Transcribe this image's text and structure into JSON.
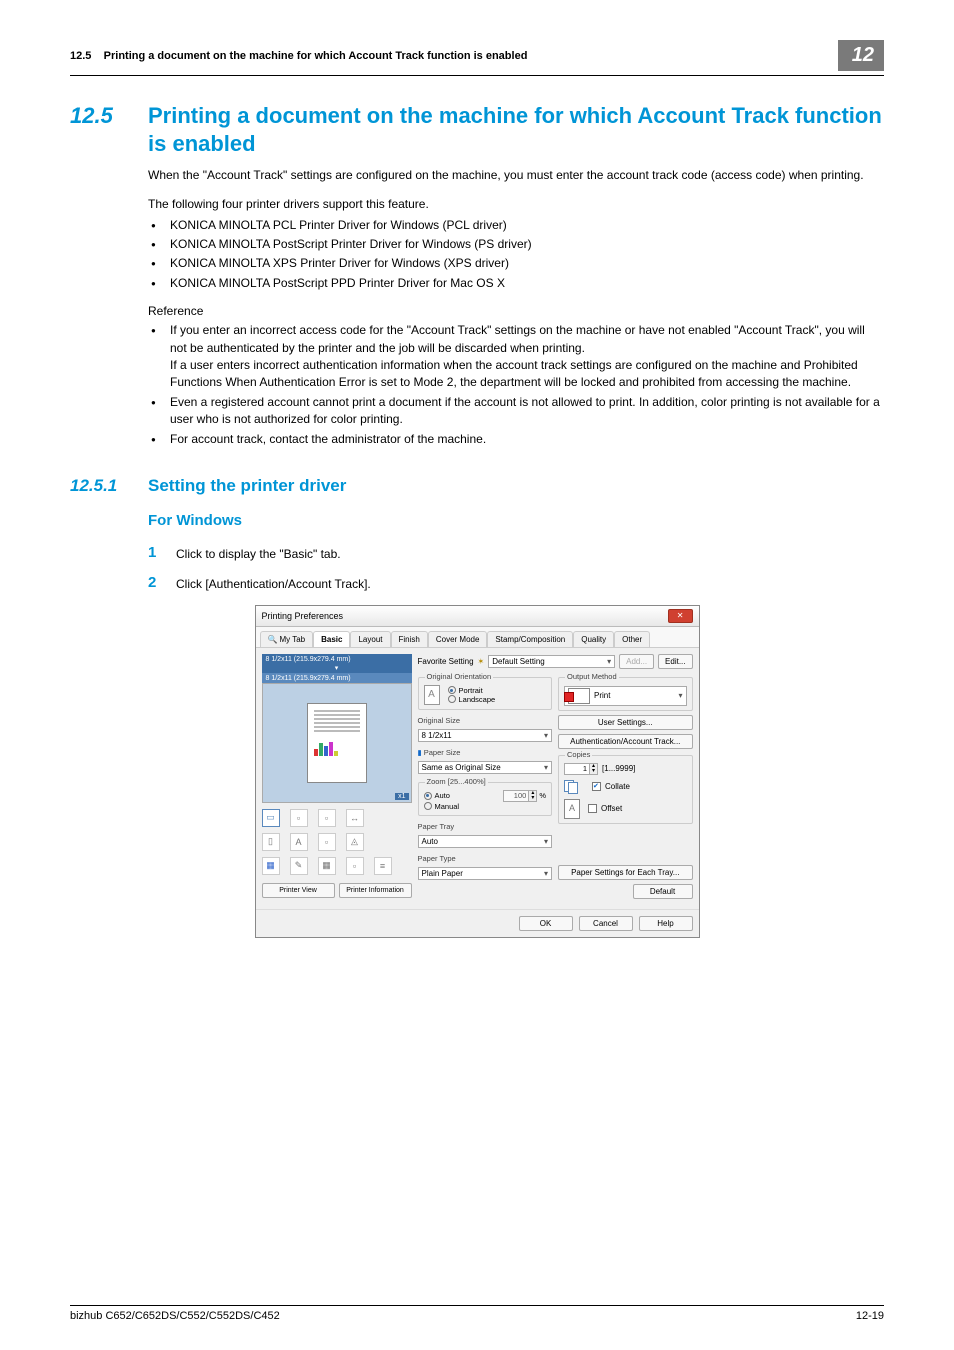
{
  "header": {
    "section_ref": "12.5",
    "running_title": "Printing a document on the machine for which Account Track function is enabled",
    "chapter_box": "12"
  },
  "section": {
    "number": "12.5",
    "title": "Printing a document on the machine for which Account Track function is enabled"
  },
  "intro1": "When the \"Account Track\" settings are configured on the machine, you must enter the account track code (access code) when printing.",
  "intro2": "The following four printer drivers support this feature.",
  "drivers": [
    "KONICA MINOLTA PCL Printer Driver for Windows (PCL driver)",
    "KONICA MINOLTA PostScript Printer Driver for Windows (PS driver)",
    "KONICA MINOLTA XPS Printer Driver for Windows (XPS driver)",
    "KONICA MINOLTA PostScript PPD Printer Driver for Mac OS X"
  ],
  "reference_label": "Reference",
  "refs": [
    "If you enter an incorrect access code for the \"Account Track\" settings on the machine or have not enabled \"Account Track\", you will not be authenticated by the printer and the job will be discarded when printing.\nIf a user enters incorrect authentication information when the account track settings are configured on the machine and Prohibited Functions When Authentication Error is set to Mode 2, the department will be locked and prohibited from accessing the machine.",
    "Even a registered account cannot print a document if the account is not allowed to print. In addition, color printing is not available for a user who is not authorized for color printing.",
    "For account track, contact the administrator of the machine."
  ],
  "subsection": {
    "number": "12.5.1",
    "title": "Setting the printer driver"
  },
  "for_windows": "For Windows",
  "steps": {
    "s1": "Click to display the \"Basic\" tab.",
    "s2": "Click [Authentication/Account Track]."
  },
  "dialog": {
    "title": "Printing Preferences",
    "tabs": [
      "My Tab",
      "Basic",
      "Layout",
      "Finish",
      "Cover Mode",
      "Stamp/Composition",
      "Quality",
      "Other"
    ],
    "preview_line1": "8 1/2x11 (215.9x279.4 mm)",
    "preview_line2": "8 1/2x11 (215.9x279.4 mm)",
    "printer_view": "Printer View",
    "printer_info": "Printer Information",
    "favorite_label": "Favorite Setting",
    "favorite_value": "Default Setting",
    "add_btn": "Add...",
    "edit_btn": "Edit...",
    "orient_group": "Original Orientation",
    "portrait": "Portrait",
    "landscape": "Landscape",
    "orig_size_label": "Original Size",
    "orig_size_value": "8 1/2x11",
    "paper_size_label": "Paper Size",
    "paper_size_value": "Same as Original Size",
    "zoom_group": "Zoom [25...400%]",
    "zoom_auto": "Auto",
    "zoom_manual": "Manual",
    "zoom_value": "100",
    "zoom_pct": "%",
    "tray_label": "Paper Tray",
    "tray_value": "Auto",
    "type_label": "Paper Type",
    "type_value": "Plain Paper",
    "output_group": "Output Method",
    "output_value": "Print",
    "user_settings": "User Settings...",
    "auth_btn": "Authentication/Account Track...",
    "copies_group": "Copies",
    "copies_value": "1",
    "copies_range": "[1...9999]",
    "collate": "Collate",
    "offset": "Offset",
    "paper_each_tray": "Paper Settings for Each Tray...",
    "default_btn": "Default",
    "ok": "OK",
    "cancel": "Cancel",
    "help": "Help"
  },
  "footer": {
    "model": "bizhub C652/C652DS/C552/C552DS/C452",
    "page": "12-19"
  }
}
